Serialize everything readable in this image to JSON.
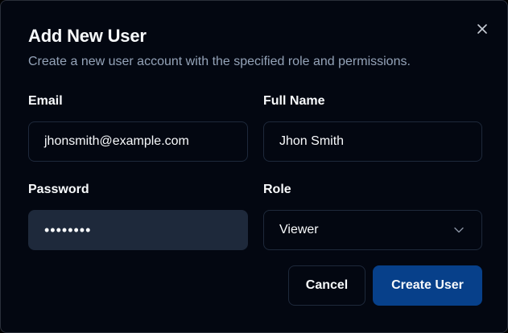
{
  "dialog": {
    "title": "Add New User",
    "description": "Create a new user account with the specified role and permissions.",
    "close_icon": "close-icon"
  },
  "form": {
    "email": {
      "label": "Email",
      "value": "jhonsmith@example.com"
    },
    "full_name": {
      "label": "Full Name",
      "value": "Jhon Smith"
    },
    "password": {
      "label": "Password",
      "value": "••••••••"
    },
    "role": {
      "label": "Role",
      "selected": "Viewer",
      "icon": "chevron-down-icon"
    }
  },
  "actions": {
    "cancel_label": "Cancel",
    "create_label": "Create User"
  },
  "colors": {
    "background": "#030711",
    "border": "#1e293b",
    "muted_text": "#94a3b8",
    "primary": "#07408a",
    "filled_input": "#1e293b"
  }
}
